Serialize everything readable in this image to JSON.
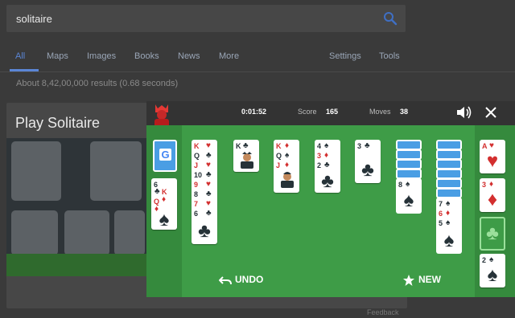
{
  "search": {
    "query": "solitaire"
  },
  "tabs": [
    {
      "label": "All",
      "active": true
    },
    {
      "label": "Maps"
    },
    {
      "label": "Images"
    },
    {
      "label": "Books"
    },
    {
      "label": "News"
    },
    {
      "label": "More"
    },
    {
      "label": "Settings"
    },
    {
      "label": "Tools"
    }
  ],
  "result_stats": "About 8,42,00,000 results (0.68 seconds)",
  "panel_title": "Play Solitaire",
  "feedback": "Feedback",
  "game": {
    "timer": "0:01:52",
    "score_label": "Score",
    "score": "165",
    "moves_label": "Moves",
    "moves": "38",
    "undo_label": "UNDO",
    "new_label": "NEW"
  },
  "colors": {
    "felt": "#3e9c47",
    "felt_dark": "#358a3d",
    "card_back": "#4a9ee4",
    "red": "#d32f2f",
    "black": "#263238",
    "accent": "#5b86d6"
  },
  "cards": {
    "waste": [
      {
        "v": "6",
        "s": "♣"
      },
      {
        "v": "K",
        "s": "♦"
      },
      {
        "v": "Q",
        "s": "♦"
      },
      {
        "v": "6",
        "s": "♠"
      }
    ],
    "t1": [
      {
        "v": "K",
        "s": "♥"
      },
      {
        "v": "Q",
        "s": "♣"
      },
      {
        "v": "J",
        "s": "♥"
      },
      {
        "v": "10",
        "s": "♣"
      },
      {
        "v": "9",
        "s": "♥"
      },
      {
        "v": "8",
        "s": "♣"
      },
      {
        "v": "7",
        "s": "♥"
      },
      {
        "v": "6",
        "s": "♣"
      }
    ],
    "t2": [
      {
        "v": "K",
        "s": "♣"
      }
    ],
    "t3": [
      {
        "v": "K",
        "s": "♦"
      },
      {
        "v": "Q",
        "s": "♠"
      },
      {
        "v": "J",
        "s": "♦"
      }
    ],
    "t4": [
      {
        "v": "4",
        "s": "♠"
      },
      {
        "v": "3",
        "s": "♦"
      },
      {
        "v": "2",
        "s": "♣"
      }
    ],
    "t5": [
      {
        "v": "3",
        "s": "♣"
      }
    ],
    "t6": [
      {
        "v": "8",
        "s": "♠"
      }
    ],
    "t7": [
      {
        "v": "7",
        "s": "♠"
      },
      {
        "v": "6",
        "s": "♦"
      },
      {
        "v": "5",
        "s": "♠"
      }
    ],
    "f1": {
      "v": "A",
      "s": "♥"
    },
    "f2": {
      "v": "3",
      "s": "♦"
    },
    "f3": {
      "s": "♣"
    },
    "f4": {
      "v": "2",
      "s": "♠"
    }
  }
}
